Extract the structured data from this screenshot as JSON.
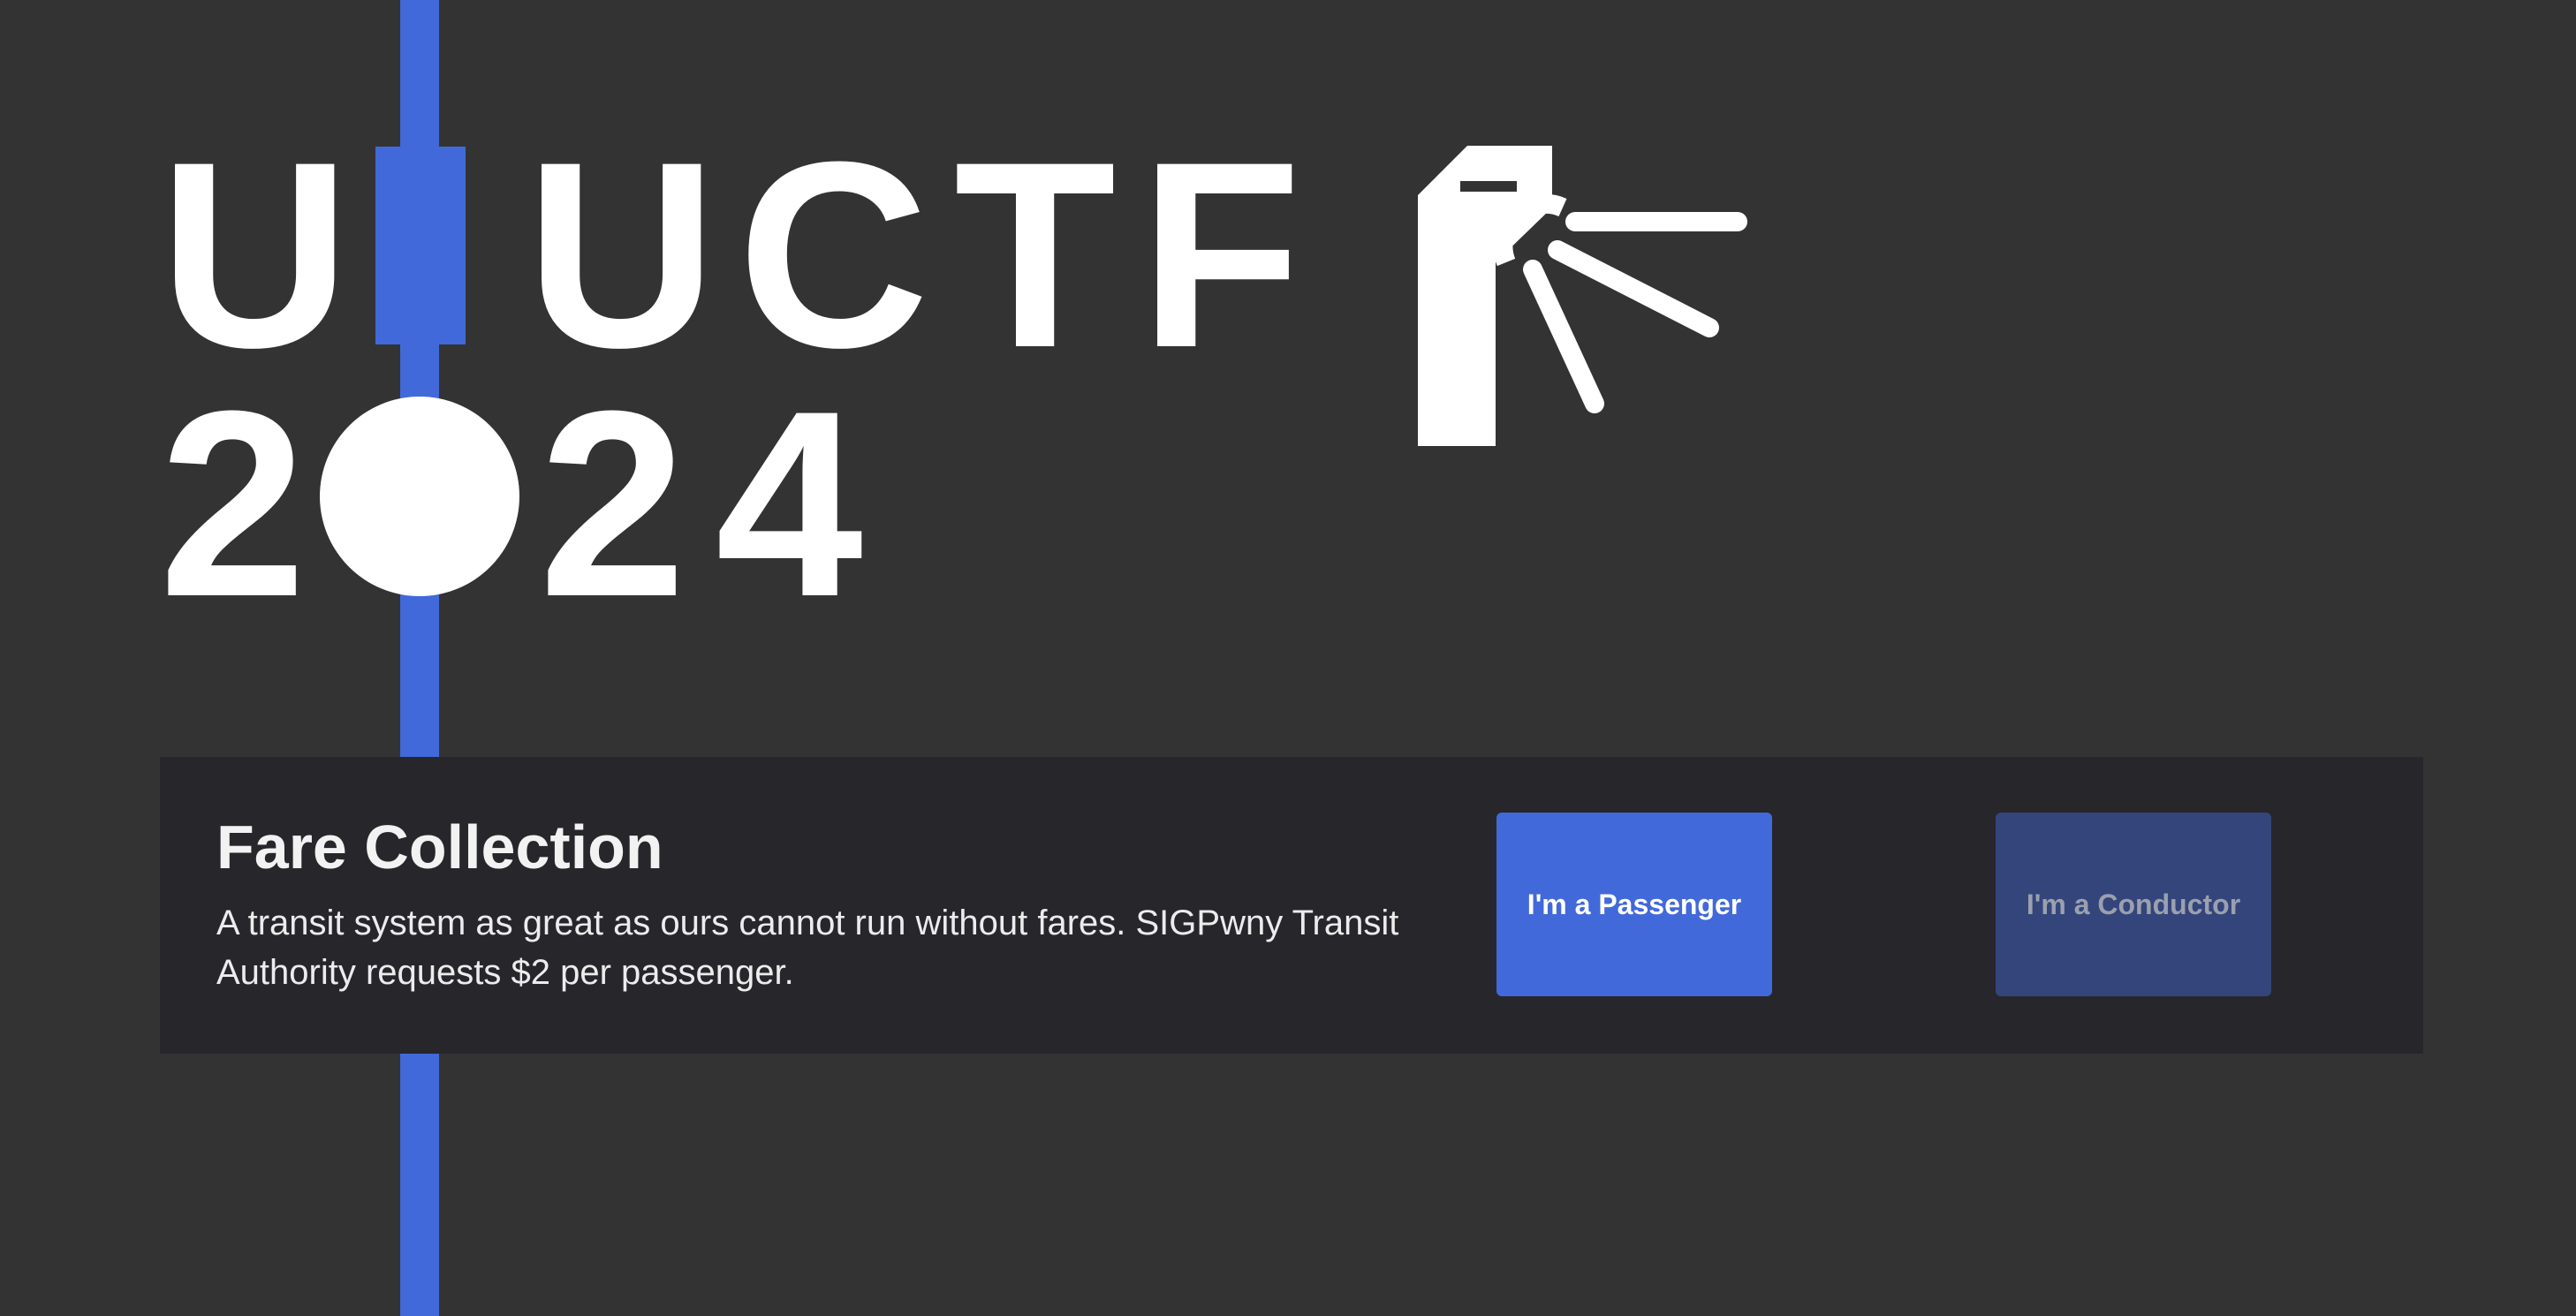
{
  "logo": {
    "row1_letters": [
      "U",
      "I",
      "U",
      "C",
      "T",
      "F"
    ],
    "row2_letters": [
      "2",
      "0",
      "2",
      "4"
    ],
    "alt_text": "UIUCTF 2024"
  },
  "icons": {
    "turnstile": "turnstile-icon"
  },
  "colors": {
    "background": "#333333",
    "panel": "#27262b",
    "accent": "#4169d9",
    "accent_disabled": "#34457c",
    "text": "#ffffff",
    "text_disabled": "#9aa0ad"
  },
  "fare_collection": {
    "title": "Fare Collection",
    "description": "A transit system as great as ours cannot run without fares. SIGPwny Transit Authority requests $2 per passenger.",
    "buttons": {
      "passenger_label": "I'm a Passenger",
      "conductor_label": "I'm a Conductor"
    }
  }
}
